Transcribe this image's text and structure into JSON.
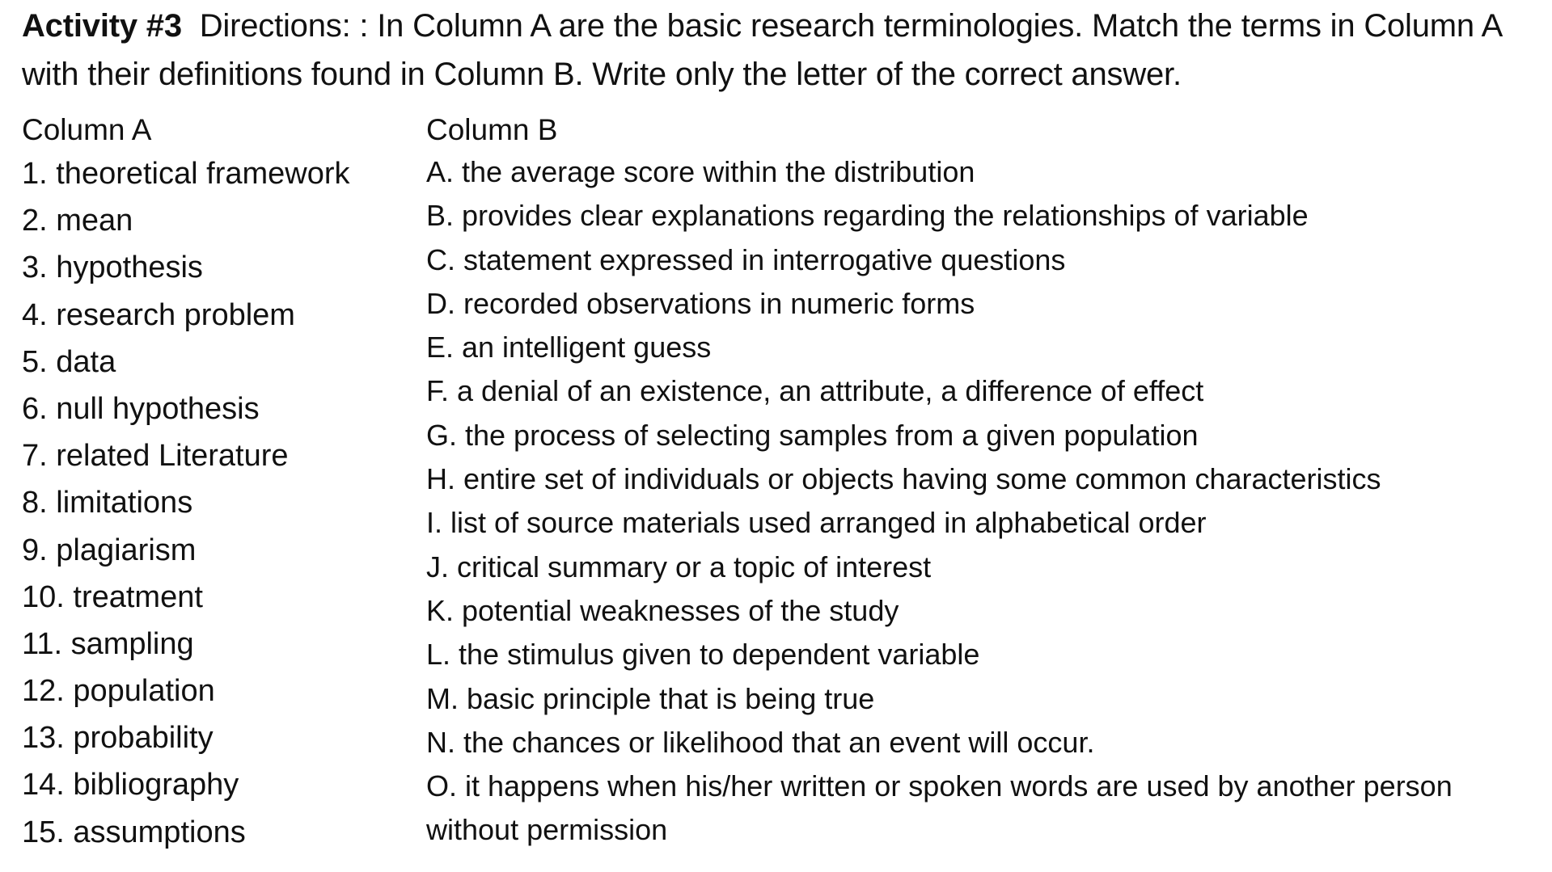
{
  "directions": {
    "activity_label": "Activity #3",
    "text": "Directions: : In Column A are the basic research terminologies. Match the terms in Column A with their definitions found in Column B. Write only the letter of the correct answer."
  },
  "column_a": {
    "header": "Column A",
    "items": [
      "1. theoretical framework",
      "2. mean",
      "3. hypothesis",
      "4. research problem",
      "5. data",
      "6. null hypothesis",
      "7. related Literature",
      "8. limitations",
      "9. plagiarism",
      "10. treatment",
      "11. sampling",
      "12. population",
      "13. probability",
      "14. bibliography",
      "15. assumptions"
    ]
  },
  "column_b": {
    "header": "Column B",
    "items": [
      "A. the average score within the distribution",
      "B. provides clear explanations regarding the relationships of variable",
      "C. statement expressed in interrogative questions",
      "D. recorded observations in numeric forms",
      "E. an intelligent guess",
      "F. a denial of an existence, an attribute, a difference of effect",
      "G. the process of selecting samples from a given population",
      "H. entire set of individuals or objects having some common characteristics",
      "I. list of source materials used arranged in alphabetical order",
      "J. critical summary or a topic of interest",
      "K. potential weaknesses of the study",
      "L. the stimulus given to dependent variable",
      "M. basic principle that is being true",
      "N. the chances or likelihood that an event will occur.",
      "O. it happens when his/her written or spoken words are used by another person",
      "without permission"
    ]
  }
}
